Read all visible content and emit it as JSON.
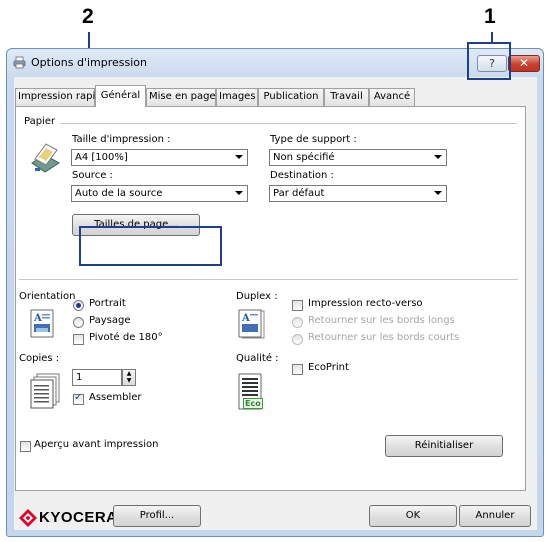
{
  "callouts": {
    "one": "1",
    "two": "2"
  },
  "window": {
    "title": "Options d'impression",
    "help_label": "?",
    "close_label": "✕"
  },
  "tabs": [
    {
      "label": "Impression rapide"
    },
    {
      "label": "Général"
    },
    {
      "label": "Mise en page"
    },
    {
      "label": "Images"
    },
    {
      "label": "Publication"
    },
    {
      "label": "Travail"
    },
    {
      "label": "Avancé"
    }
  ],
  "paper": {
    "group_label": "Papier",
    "size_label": "Taille d'impression :",
    "size_value": "A4  [100%]",
    "media_label": "Type de support :",
    "media_value": "Non spécifié",
    "source_label": "Source :",
    "source_value": "Auto de la source",
    "dest_label": "Destination :",
    "dest_value": "Par défaut",
    "page_sizes_button": "Tailles de page..."
  },
  "orientation": {
    "label": "Orientation",
    "portrait": "Portrait",
    "landscape": "Paysage",
    "rotate": "Pivoté de 180°"
  },
  "duplex": {
    "label": "Duplex :",
    "two_sided": "Impression recto-verso",
    "long_edge": "Retourner sur les bords longs",
    "short_edge": "Retourner sur les bords courts"
  },
  "copies": {
    "label": "Copies :",
    "value": "1",
    "collate": "Assembler"
  },
  "quality": {
    "label": "Qualité :",
    "ecoprint": "EcoPrint",
    "eco_badge": "Eco"
  },
  "preview_label": "Aperçu avant impression",
  "reset_button": "Réinitialiser",
  "footer": {
    "brand": "KYOCERA",
    "profile_button": "Profil...",
    "ok_button": "OK",
    "cancel_button": "Annuler"
  },
  "colors": {
    "callout": "#1f3f8f",
    "brand_red": "#e4002b"
  }
}
